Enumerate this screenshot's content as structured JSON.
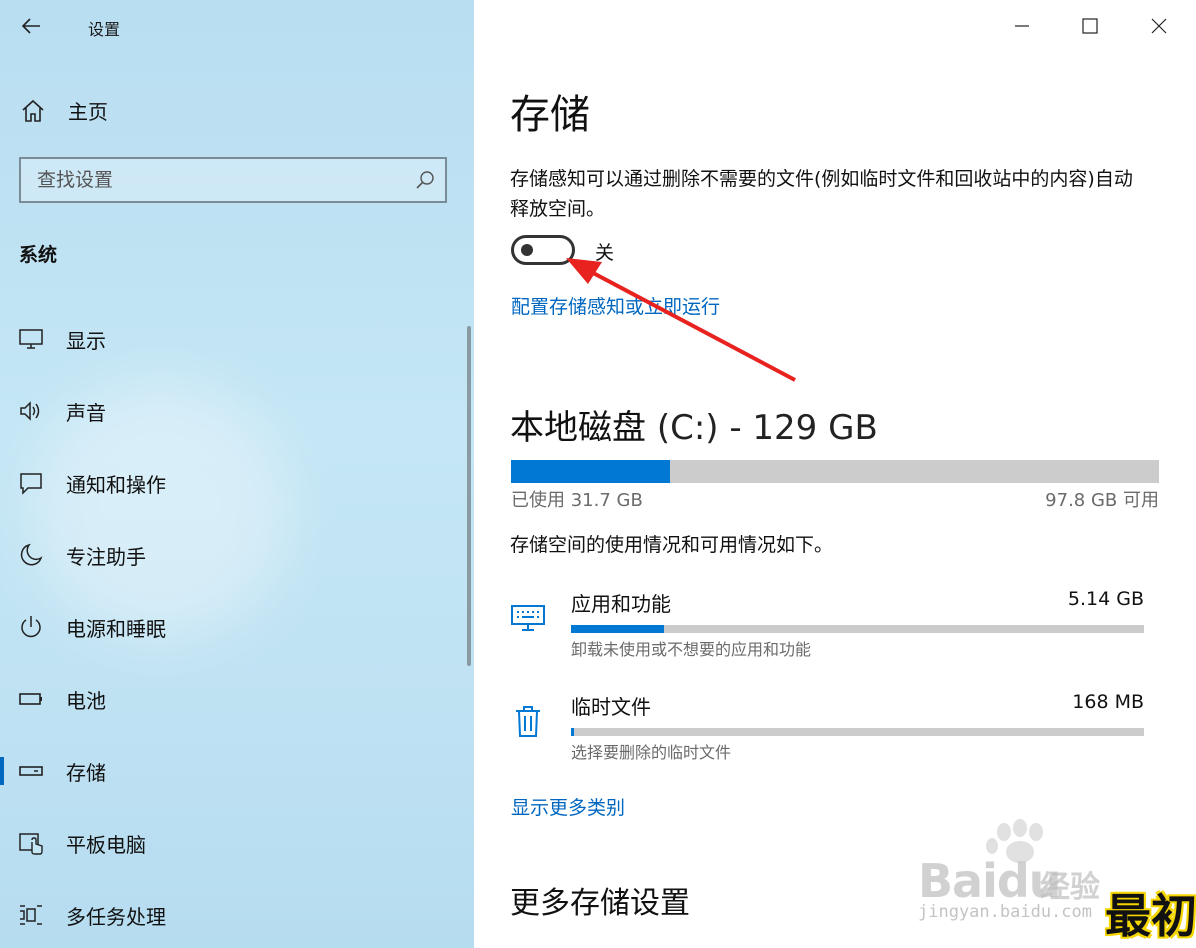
{
  "window": {
    "title": "设置"
  },
  "sidebar": {
    "home_label": "主页",
    "search_placeholder": "查找设置",
    "section_title": "系统",
    "items": [
      {
        "label": "显示",
        "icon": "monitor-icon"
      },
      {
        "label": "声音",
        "icon": "speaker-icon"
      },
      {
        "label": "通知和操作",
        "icon": "notification-icon"
      },
      {
        "label": "专注助手",
        "icon": "moon-icon"
      },
      {
        "label": "电源和睡眠",
        "icon": "power-icon"
      },
      {
        "label": "电池",
        "icon": "battery-icon"
      },
      {
        "label": "存储",
        "icon": "storage-icon",
        "active": true
      },
      {
        "label": "平板电脑",
        "icon": "tablet-icon"
      },
      {
        "label": "多任务处理",
        "icon": "multitask-icon"
      }
    ]
  },
  "main": {
    "title": "存储",
    "description": "存储感知可以通过删除不需要的文件(例如临时文件和回收站中的内容)自动释放空间。",
    "toggle": {
      "state": "off",
      "label": "关"
    },
    "config_link": "配置存储感知或立即运行",
    "disk": {
      "title": "本地磁盘",
      "drive": "(C:) - 129 GB",
      "used_label": "已使用 31.7 GB",
      "free_label": "97.8 GB 可用",
      "used_fraction": 0.245
    },
    "usage_desc": "存储空间的使用情况和可用情况如下。",
    "categories": [
      {
        "name": "应用和功能",
        "size": "5.14 GB",
        "sub": "卸载未使用或不想要的应用和功能",
        "fraction": 0.163,
        "icon": "apps-icon"
      },
      {
        "name": "临时文件",
        "size": "168 MB",
        "sub": "选择要删除的临时文件",
        "fraction": 0.005,
        "icon": "trash-icon"
      }
    ],
    "more_link": "显示更多类别",
    "more_settings": "更多存储设置"
  },
  "watermark": {
    "brand": "Baidu",
    "brand_cn": "经验",
    "url": "jingyan.baidu.com",
    "corner": "最初"
  },
  "colors": {
    "accent": "#0078d4",
    "link": "#0067c0",
    "bar_bg": "#cccccc"
  }
}
